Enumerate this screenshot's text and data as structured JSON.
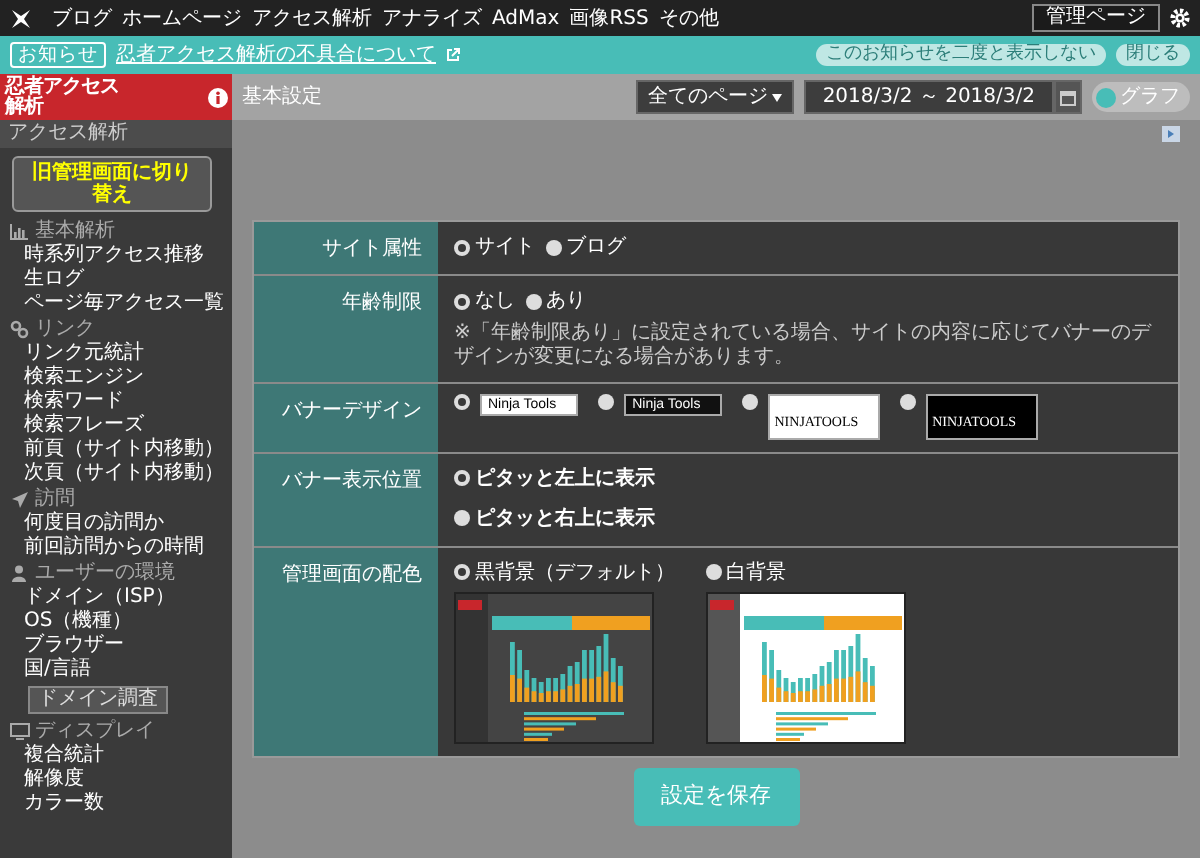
{
  "top_nav": {
    "items": [
      "ブログ",
      "ホームページ",
      "アクセス解析",
      "アナライズ",
      "AdMax",
      "画像RSS",
      "その他"
    ],
    "admin_button": "管理ページ"
  },
  "notice": {
    "badge": "お知らせ",
    "link": "忍者アクセス解析の不具合について",
    "dismiss": "このお知らせを二度と表示しない",
    "close": "閉じる"
  },
  "sidebar": {
    "logo": "忍者アクセス解析",
    "heading": "アクセス解析",
    "switch_banner": "旧管理画面に切り替え",
    "sections": [
      {
        "title": "基本解析",
        "kind": "chart",
        "items": [
          "時系列アクセス推移",
          "生ログ",
          "ページ毎アクセス一覧"
        ]
      },
      {
        "title": "リンク",
        "kind": "link",
        "items": [
          "リンク元統計",
          "検索エンジン",
          "検索ワード",
          "検索フレーズ",
          "前頁（サイト内移動）",
          "次頁（サイト内移動）"
        ]
      },
      {
        "title": "訪問",
        "kind": "visit",
        "items": [
          "何度目の訪問か",
          "前回訪問からの時間"
        ]
      },
      {
        "title": "ユーザーの環境",
        "kind": "user",
        "items": [
          "ドメイン（ISP）",
          "OS（機種）",
          "ブラウザー",
          "国/言語"
        ],
        "button": "ドメイン調査"
      },
      {
        "title": "ディスプレイ",
        "kind": "display",
        "items": [
          "複合統計",
          "解像度",
          "カラー数"
        ]
      }
    ]
  },
  "header": {
    "title": "基本設定",
    "page_select": "全てのページ",
    "date_range": "2018/3/2 ～ 2018/3/2",
    "graph_toggle": "グラフ"
  },
  "settings": [
    {
      "label": "サイト属性",
      "kind": "inline",
      "options": [
        {
          "label": "サイト",
          "selected": true
        },
        {
          "label": "ブログ",
          "selected": false
        }
      ]
    },
    {
      "label": "年齢制限",
      "kind": "inline",
      "options": [
        {
          "label": "なし",
          "selected": true
        },
        {
          "label": "あり",
          "selected": false
        }
      ],
      "note": "※「年齢制限あり」に設定されている場合、サイトの内容に応じてバナーのデザインが変更になる場合があります。"
    },
    {
      "label": "バナーデザイン",
      "kind": "banner",
      "options": [
        {
          "label": "Ninja Tools",
          "kind": "small_light",
          "selected": true
        },
        {
          "label": "Ninja Tools",
          "kind": "small_dark",
          "selected": false
        },
        {
          "label": "NINJATOOLS",
          "kind": "large_light",
          "selected": false
        },
        {
          "label": "NINJATOOLS",
          "kind": "large_dark",
          "selected": false
        }
      ]
    },
    {
      "label": "バナー表示位置",
      "kind": "stacked",
      "options": [
        {
          "label": "ピタッと左上に表示",
          "selected": true
        },
        {
          "label": "ピタッと右上に表示",
          "selected": false
        }
      ]
    },
    {
      "label": "管理画面の配色",
      "kind": "theme",
      "options": [
        {
          "label": "黒背景（デフォルト）",
          "kind": "dark",
          "selected": true
        },
        {
          "label": "白背景",
          "kind": "light",
          "selected": false
        }
      ]
    }
  ],
  "save_button": "設定を保存"
}
